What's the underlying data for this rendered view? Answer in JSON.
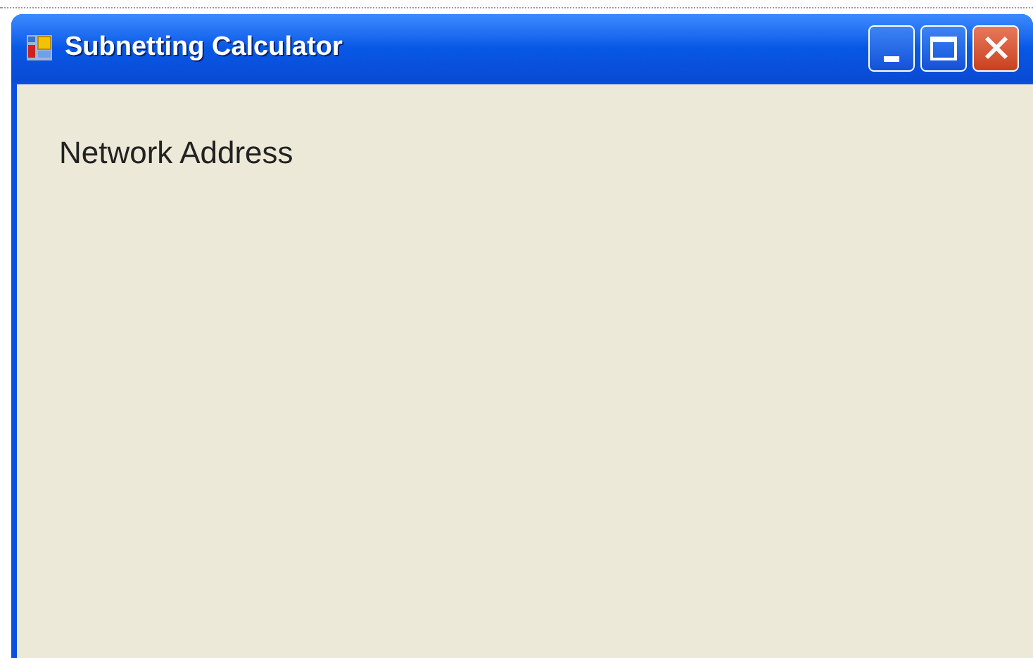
{
  "window": {
    "title": "Subnetting Calculator"
  },
  "content": {
    "label": "Network Address"
  }
}
